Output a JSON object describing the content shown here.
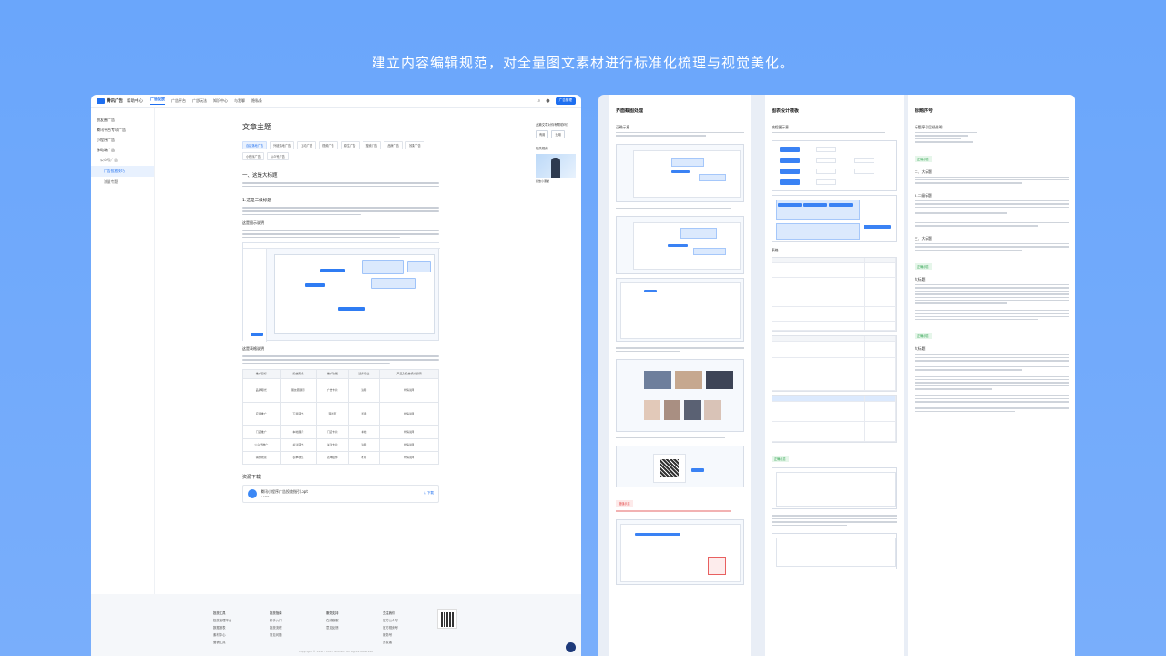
{
  "headline": "建立内容编辑规范，对全量图文素材进行标准化梳理与视觉美化。",
  "left": {
    "brand": "腾讯广告",
    "brand_sub": "帮助中心",
    "nav": [
      "广告投放",
      "广告平台",
      "广告玩法",
      "知识中心",
      "与我聊",
      "隐私条"
    ],
    "nav_active": 0,
    "topbar_action": "广告管理",
    "sidebar": [
      {
        "label": "朋友圈广告",
        "level": 0
      },
      {
        "label": "腾讯平台专项广告",
        "level": 0
      },
      {
        "label": "小程序广告",
        "level": 0
      },
      {
        "label": "移动端广告",
        "level": 0
      },
      {
        "label": "公众号广告",
        "level": 1
      },
      {
        "label": "广告投放技巧",
        "level": 2,
        "active": true
      },
      {
        "label": "流量专题",
        "level": 2
      }
    ],
    "article_title": "文章主题",
    "tags": [
      "自建落地广告",
      "外链落地广告",
      "互动广告",
      "视频广告",
      "原生广告",
      "搜索广告",
      "品牌广告",
      "效果广告",
      "小程序广告",
      "公众号广告"
    ],
    "h1": "一、这是大标题",
    "h2": "1.这是二级标题",
    "h3a": "这是图示说明",
    "h3b": "这是表格说明",
    "table_headers": [
      "推广目标",
      "投放形式",
      "推广功能",
      "适用行业",
      "产品及投放机制说明"
    ],
    "table_rows": [
      [
        "品牌曝光",
        "朋友圈展示",
        "广告卡片",
        "通用",
        "详情说明"
      ],
      [
        "应用推广",
        "下载转化",
        "落地页",
        "游戏",
        "详情说明"
      ],
      [
        "门店推广",
        "本地展示",
        "门店卡片",
        "本地",
        "详情说明"
      ],
      [
        "公众号推广",
        "关注转化",
        "关注卡片",
        "通用",
        "详情说明"
      ],
      [
        "销售线索",
        "表单收集",
        "表单组件",
        "教育",
        "详情说明"
      ]
    ],
    "download_title": "资源下载",
    "download_file": "腾讯小程序广告投放指引.ppt",
    "download_size": "2.6MB",
    "download_link": "下载",
    "right_title": "此篇文章对你有帮助吗？",
    "right_btn_yes": "有用",
    "right_btn_no": "没用",
    "right_video_title": "相关视频",
    "right_video_caption": "投放小课堂",
    "footer_cols": [
      {
        "title": "投放工具",
        "items": [
          "投放管理平台",
          "数据报表",
          "素材中心",
          "营销工具"
        ]
      },
      {
        "title": "投放指南",
        "items": [
          "新手入门",
          "投放流程",
          "常见问题"
        ]
      },
      {
        "title": "服务支持",
        "items": [
          "在线客服",
          "意见反馈"
        ]
      },
      {
        "title": "关注我们",
        "items": [
          "官方公众号",
          "官方视频号",
          "服务号",
          "开发者"
        ]
      }
    ],
    "footer_copy": "Copyright © 1998 - 2023 Tencent. All Rights Reserved."
  },
  "right": {
    "panels": [
      {
        "title": "界面截图处理",
        "sub": "正确示意"
      },
      {
        "title": "图表设计模板",
        "sub": "流程图示意"
      },
      {
        "title": "标题序号",
        "sub": "标题序号层级说明"
      }
    ],
    "p1_tag_red": "错误示意",
    "p2_sub2": "表格",
    "p2_tag_green": "正确示意",
    "p3_headings": [
      "二、大标题",
      "2.二级标题",
      "三、大标题",
      "大标题",
      "大标题"
    ]
  }
}
